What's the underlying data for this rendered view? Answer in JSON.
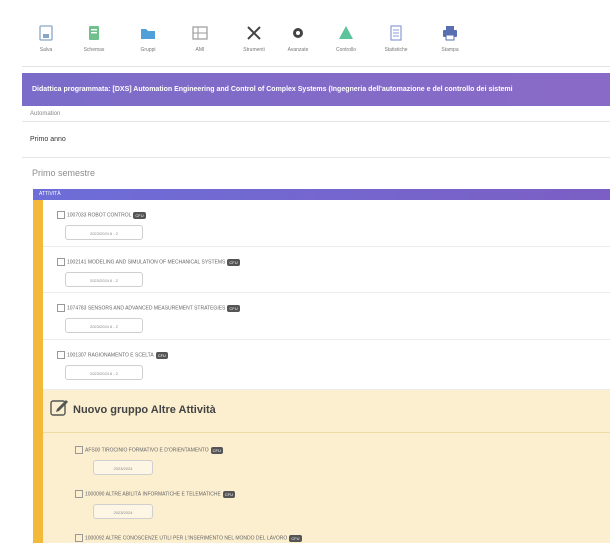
{
  "toolbar": {
    "items": [
      {
        "label": "Salva",
        "icon": "save-icon"
      },
      {
        "label": "Schemas",
        "icon": "sheet-icon"
      },
      {
        "label": "Gruppi",
        "icon": "folder-icon"
      },
      {
        "label": "AMI",
        "icon": "grid-icon"
      },
      {
        "label": "Strumenti",
        "icon": "tools-icon"
      },
      {
        "label": "Avanzate",
        "icon": "gear-icon"
      },
      {
        "label": "Controllo",
        "icon": "triangle-icon"
      },
      {
        "label": "Statistiche",
        "icon": "list-icon"
      },
      {
        "label": "Stampa",
        "icon": "print-icon"
      }
    ]
  },
  "header": {
    "title": "Didattica programmata: [DXS] Automation Engineering and Control of Complex Systems (Ingegneria dell'automazione e del controllo dei sistemi"
  },
  "breadcrumb": "Automation",
  "year": "Primo anno",
  "semester": "Primo semestre",
  "activity_header": "ATTIVITÀ",
  "courses": [
    {
      "title": "1007033 ROBOT CONTROL",
      "badge": "CFU",
      "pill": "2023/2024 6 - 2"
    },
    {
      "title": "1002141 MODELING AND SIMULATION OF MECHANICAL SYSTEMS",
      "badge": "CFU",
      "pill": "2023/2024 6 - 2"
    },
    {
      "title": "1074783 SENSORS AND ADVANCED MEASUREMENT STRATEGIES",
      "badge": "CFU",
      "pill": "2023/2024 6 - 2"
    },
    {
      "title": "1001307 RAGIONAMENTO E SCELTA",
      "badge": "CFU",
      "pill": "2023/2024 6 - 2"
    }
  ],
  "group": {
    "title": "Nuovo gruppo Altre Attività",
    "items": [
      {
        "title": "AFS00 TIROCINIO FORMATIVO E D'ORIENTAMENTO",
        "badge": "CFU",
        "pill": "2023/2024"
      },
      {
        "title": "1000090 ALTRE ABILITÀ INFORMATICHE E TELEMATICHE",
        "badge": "CFU",
        "pill": "2023/2024"
      },
      {
        "title": "1000092 ALTRE CONOSCENZE UTILI PER L'INSERIMENTO NEL MONDO DEL LAVORO",
        "badge": "CFU"
      }
    ]
  },
  "colors": {
    "header_band": "#7b6cc9",
    "accent_stripe": "#f3b93a",
    "group_bg": "#fcefd0"
  }
}
